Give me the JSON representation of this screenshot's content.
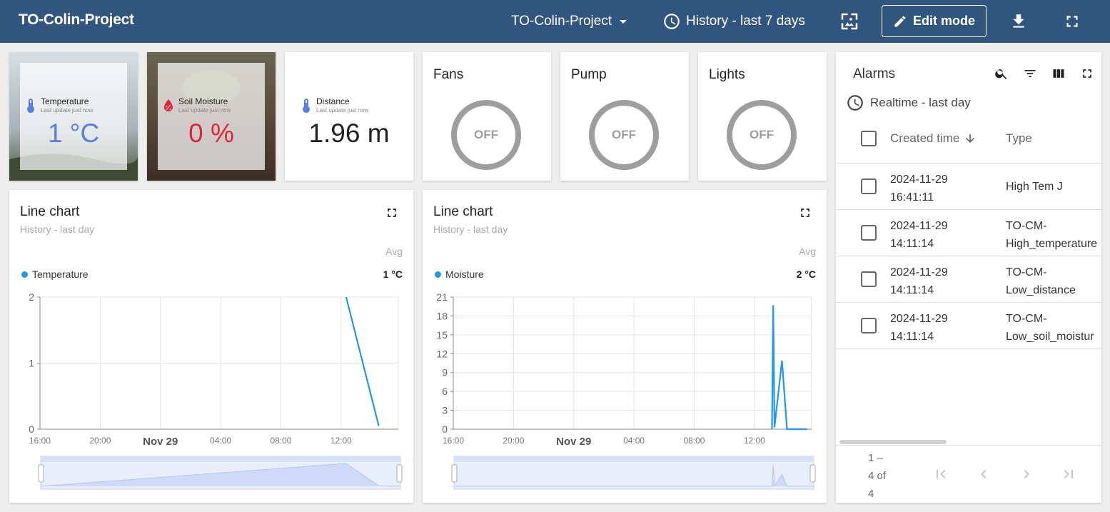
{
  "topbar": {
    "title": "TO-Colin-Project",
    "dashboard_select": "TO-Colin-Project",
    "timewindow": "History - last 7 days",
    "edit_mode": "Edit mode"
  },
  "values": [
    {
      "label": "Temperature",
      "sub": "Last update just now",
      "value": "1 °C",
      "color": "#5b7fe0",
      "icon": "thermometer-icon"
    },
    {
      "label": "Soil Moisture",
      "sub": "Last update just now",
      "value": "0 %",
      "color": "#e0243b",
      "icon": "water-percent-icon"
    },
    {
      "label": "Distance",
      "sub": "Last update just now",
      "value": "1.96 m",
      "color": "#212121",
      "icon": "thermometer-icon"
    }
  ],
  "switches": [
    {
      "title": "Fans",
      "state": "OFF"
    },
    {
      "title": "Pump",
      "state": "OFF"
    },
    {
      "title": "Lights",
      "state": "OFF"
    }
  ],
  "charts": [
    {
      "title": "Line chart",
      "subtitle": "History - last day",
      "avg_label": "Avg",
      "series_name": "Temperature",
      "series_value": "1 °C"
    },
    {
      "title": "Line chart",
      "subtitle": "History - last day",
      "avg_label": "Avg",
      "series_name": "Moisture",
      "series_value": "2 °C"
    }
  ],
  "chart_data": [
    {
      "type": "line",
      "title": "Line chart",
      "x_ticks": [
        "16:00",
        "20:00",
        "Nov 29",
        "04:00",
        "08:00",
        "12:00"
      ],
      "y_ticks": [
        0,
        1,
        2
      ],
      "ylim": [
        0,
        2
      ],
      "series": [
        {
          "name": "Temperature",
          "color": "#2196f3",
          "x": [
            "12:20",
            "14:30"
          ],
          "values": [
            2,
            0.05
          ]
        }
      ],
      "grid": true
    },
    {
      "type": "line",
      "title": "Line chart",
      "x_ticks": [
        "16:00",
        "20:00",
        "Nov 29",
        "04:00",
        "08:00",
        "12:00"
      ],
      "y_ticks": [
        0,
        3,
        6,
        9,
        12,
        15,
        18,
        21
      ],
      "ylim": [
        0,
        21
      ],
      "series": [
        {
          "name": "Moisture",
          "color": "#2196f3",
          "x": [
            "13:10",
            "13:15",
            "13:20",
            "13:50",
            "14:10",
            "15:30"
          ],
          "values": [
            0,
            19.7,
            0.3,
            10.9,
            0,
            0
          ]
        }
      ],
      "grid": true
    }
  ],
  "alarms": {
    "title": "Alarms",
    "timewindow": "Realtime - last day",
    "columns": [
      "Created time",
      "Type"
    ],
    "rows": [
      {
        "time": [
          "2024-11-29",
          "16:41:11"
        ],
        "type": [
          "High Tem J"
        ]
      },
      {
        "time": [
          "2024-11-29",
          "14:11:14"
        ],
        "type": [
          "TO-CM-",
          "High_temperature"
        ]
      },
      {
        "time": [
          "2024-11-29",
          "14:11:14"
        ],
        "type": [
          "TO-CM-",
          "Low_distance"
        ]
      },
      {
        "time": [
          "2024-11-29",
          "14:11:14"
        ],
        "type": [
          "TO-CM-",
          "Low_soil_moistur"
        ]
      }
    ],
    "pager": [
      "1 –",
      "4 of",
      "4"
    ]
  }
}
